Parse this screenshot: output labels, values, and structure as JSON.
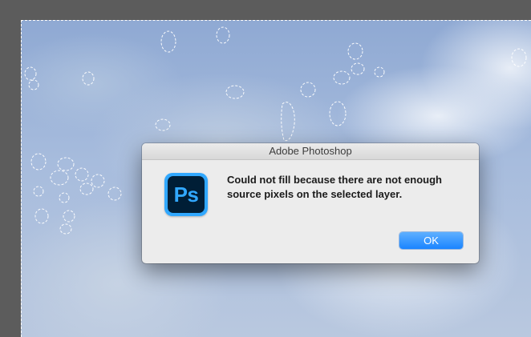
{
  "dialog": {
    "title": "Adobe Photoshop",
    "message": "Could not fill because there are not enough source pixels on the selected layer.",
    "ok_label": "OK"
  },
  "app_icon": {
    "text": "Ps",
    "name": "photoshop-app-icon",
    "colors": {
      "frame": "#31a8ff",
      "background": "#001e36",
      "letters": "#31a8ff"
    }
  },
  "colors": {
    "workspace": "#5c5c5c",
    "dialog_background": "#ececec",
    "button_accent": "#1a84ff"
  }
}
